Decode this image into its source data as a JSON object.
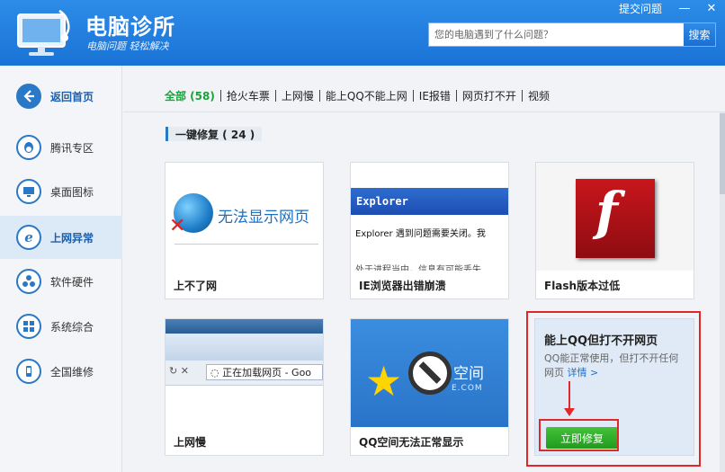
{
  "header": {
    "title": "电脑诊所",
    "slogan": "电脑问题 轻松解决",
    "feedback_label": "提交问题",
    "minimize_glyph": "—",
    "close_glyph": "✕",
    "search_placeholder": "您的电脑遇到了什么问题？",
    "search_button": "搜索"
  },
  "sidebar": {
    "items": [
      {
        "label": "返回首页",
        "icon": "back-arrow-icon"
      },
      {
        "label": "腾讯专区",
        "icon": "qq-penguin-icon"
      },
      {
        "label": "桌面图标",
        "icon": "monitor-icon"
      },
      {
        "label": "上网异常",
        "icon": "ie-icon"
      },
      {
        "label": "软件硬件",
        "icon": "fan-icon"
      },
      {
        "label": "系统综合",
        "icon": "windows-icon"
      },
      {
        "label": "全国维修",
        "icon": "phone-icon"
      }
    ],
    "active_index": 3
  },
  "tabs": [
    {
      "label": "全部 (58)"
    },
    {
      "label": "抢火车票"
    },
    {
      "label": "上网慢"
    },
    {
      "label": "能上QQ不能上网"
    },
    {
      "label": "IE报错"
    },
    {
      "label": "网页打不开"
    },
    {
      "label": "视频"
    }
  ],
  "section": {
    "title": "一键修复 ( 24 )"
  },
  "cards": [
    {
      "title": "上不了网",
      "thumb_text": "无法显示网页"
    },
    {
      "title": "IE浏览器出错崩溃",
      "thumb_bar": "Explorer",
      "thumb_msg": "Explorer 遇到问题需要关闭。我",
      "thumb_msg2": "处于进程当中，信息有可能丢失"
    },
    {
      "title": "Flash版本过低",
      "thumb_letter": "f"
    },
    {
      "title": "上网慢",
      "thumb_nav": "↻ ✕",
      "thumb_url": "◌ 正在加载网页 - Goo"
    },
    {
      "title": "QQ空间无法正常显示",
      "thumb_brand": "空间",
      "thumb_domain": "E.COM"
    }
  ],
  "feature": {
    "title": "能上QQ但打不开网页",
    "desc": "QQ能正常使用，但打不开任何网页",
    "link": "详情 >",
    "button": "立即修复"
  }
}
